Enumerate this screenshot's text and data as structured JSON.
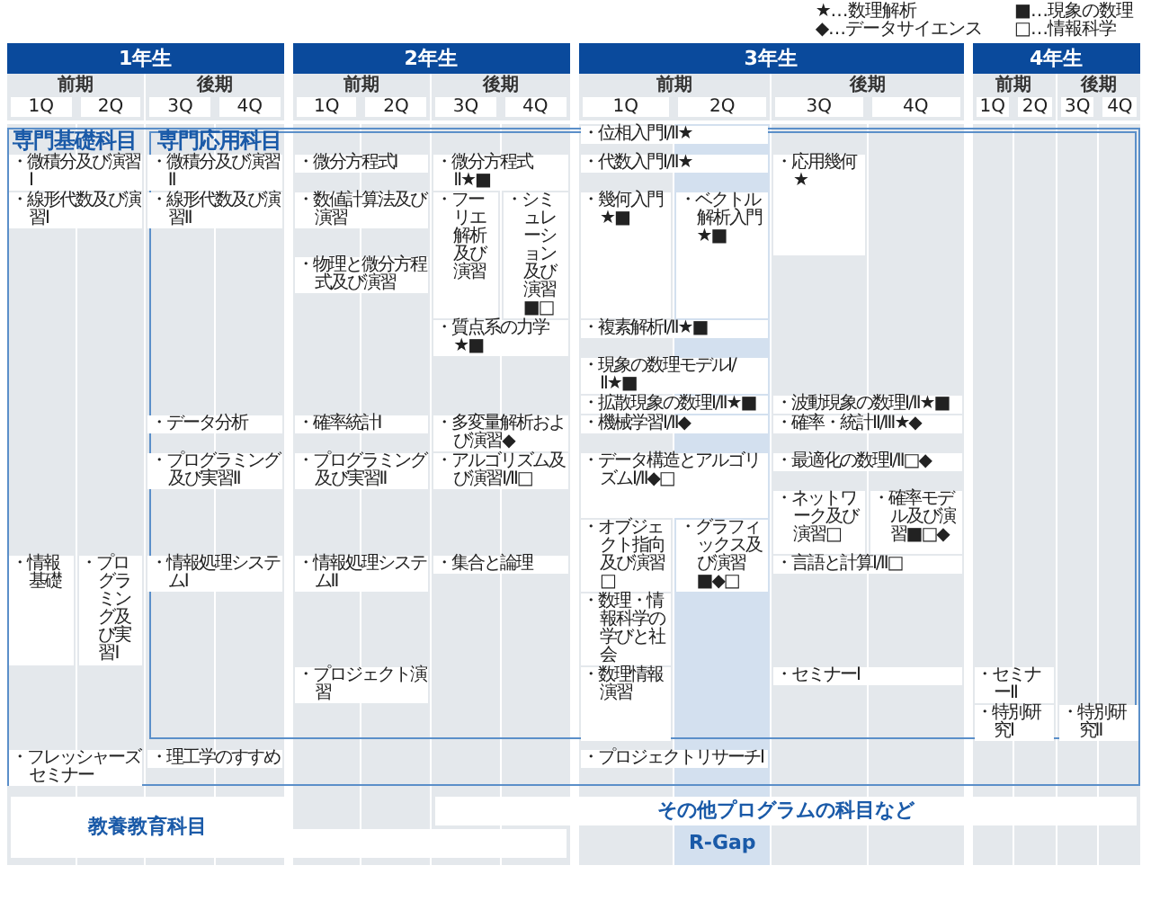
{
  "legend": [
    "★…数理解析",
    "■…現象の数理",
    "◆…データサイエンス",
    "□…情報科学"
  ],
  "years": [
    {
      "label": "1年生",
      "terms": [
        {
          "label": "前期",
          "quarters": [
            "1Q",
            "2Q"
          ]
        },
        {
          "label": "後期",
          "quarters": [
            "3Q",
            "4Q"
          ]
        }
      ]
    },
    {
      "label": "2年生",
      "terms": [
        {
          "label": "前期",
          "quarters": [
            "1Q",
            "2Q"
          ]
        },
        {
          "label": "後期",
          "quarters": [
            "3Q",
            "4Q"
          ]
        }
      ]
    },
    {
      "label": "3年生",
      "terms": [
        {
          "label": "前期",
          "quarters": [
            "1Q",
            "2Q"
          ]
        },
        {
          "label": "後期",
          "quarters": [
            "3Q",
            "4Q"
          ]
        }
      ]
    },
    {
      "label": "4年生",
      "terms": [
        {
          "label": "前期",
          "quarters": [
            "1Q",
            "2Q"
          ]
        },
        {
          "label": "後期",
          "quarters": [
            "3Q",
            "4Q"
          ]
        }
      ]
    }
  ],
  "sections": [
    {
      "title": "専門基礎科目"
    },
    {
      "title": "専門応用科目"
    }
  ],
  "courses": [
    "・位相入門Ⅰ/Ⅱ★",
    "・微積分及び演習Ⅰ",
    "・微積分及び演習Ⅱ",
    "・微分方程式Ⅰ",
    "・微分方程式Ⅱ★■",
    "・代数入門Ⅰ/Ⅱ★",
    "・応用幾何★",
    "・線形代数及び演習Ⅰ",
    "・線形代数及び演習Ⅱ",
    "・数値計算法及び演習",
    "・フーリエ解析及び演習",
    "・シミュレーション及び演習■□",
    "・幾何入門★■",
    "・ベクトル解析入門★■",
    "・物理と微分方程式及び演習",
    "・質点系の力学★■",
    "・複素解析Ⅰ/Ⅱ★■",
    "・現象の数理モデルⅠ/Ⅱ★■",
    "・拡散現象の数理Ⅰ/Ⅱ★■",
    "・波動現象の数理Ⅰ/Ⅱ★■",
    "・データ分析",
    "・確率統計Ⅰ",
    "・多変量解析および演習◆",
    "・機械学習Ⅰ/Ⅱ◆",
    "・確率・統計Ⅱ/Ⅲ★◆",
    "・プログラミング及び実習Ⅱ",
    "・プログラミング及び実習Ⅱ",
    "・アルゴリズム及び演習Ⅰ/Ⅱ□",
    "・データ構造とアルゴリズムⅠ/Ⅱ◆□",
    "・最適化の数理Ⅰ/Ⅱ□◆",
    "・ネットワーク及び演習□",
    "・確率モデル及び演習■□◆",
    "・情報基礎",
    "・プログラミング及び実習Ⅰ",
    "・情報処理システムⅠ",
    "・情報処理システムⅡ",
    "・集合と論理",
    "・オブジェクト指向及び演習□",
    "・グラフィックス及び演習■◆□",
    "・言語と計算Ⅰ/Ⅱ□",
    "・数理・情報科学の学びと社会",
    "・プロジェクト演習",
    "・数理情報演習",
    "・セミナーⅠ",
    "・セミナーⅡ",
    "・特別研究Ⅰ",
    "・特別研究Ⅱ",
    "・フレッシャーズセミナー",
    "・理工学のすすめ",
    "・プロジェクトリサーチⅠ"
  ],
  "other_programs": {
    "label": "その他プログラムの科目など"
  },
  "general_education": {
    "label": "教養教育科目"
  },
  "r_gap": {
    "label": "R-Gap"
  }
}
